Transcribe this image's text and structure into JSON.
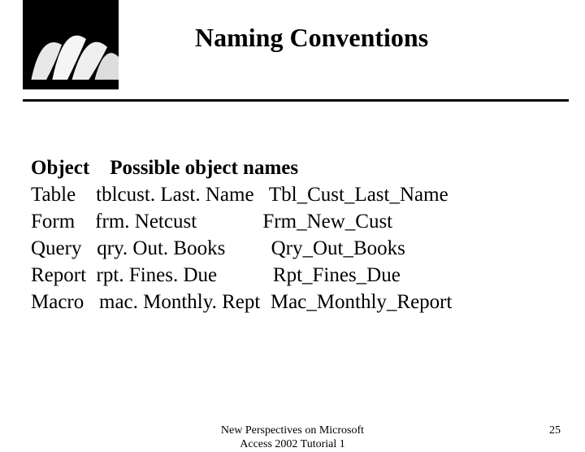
{
  "title": "Naming Conventions",
  "header_row": "Object    Possible object names",
  "rows": [
    "Table    tblcust. Last. Name   Tbl_Cust_Last_Name",
    "Form    frm. Netcust             Frm_New_Cust",
    "Query   qry. Out. Books         Qry_Out_Books",
    "Report  rpt. Fines. Due           Rpt_Fines_Due",
    "Macro   mac. Monthly. Rept  Mac_Monthly_Report"
  ],
  "footer": {
    "line1": "New Perspectives on Microsoft",
    "line2": "Access 2002 Tutorial 1",
    "page": "25"
  }
}
